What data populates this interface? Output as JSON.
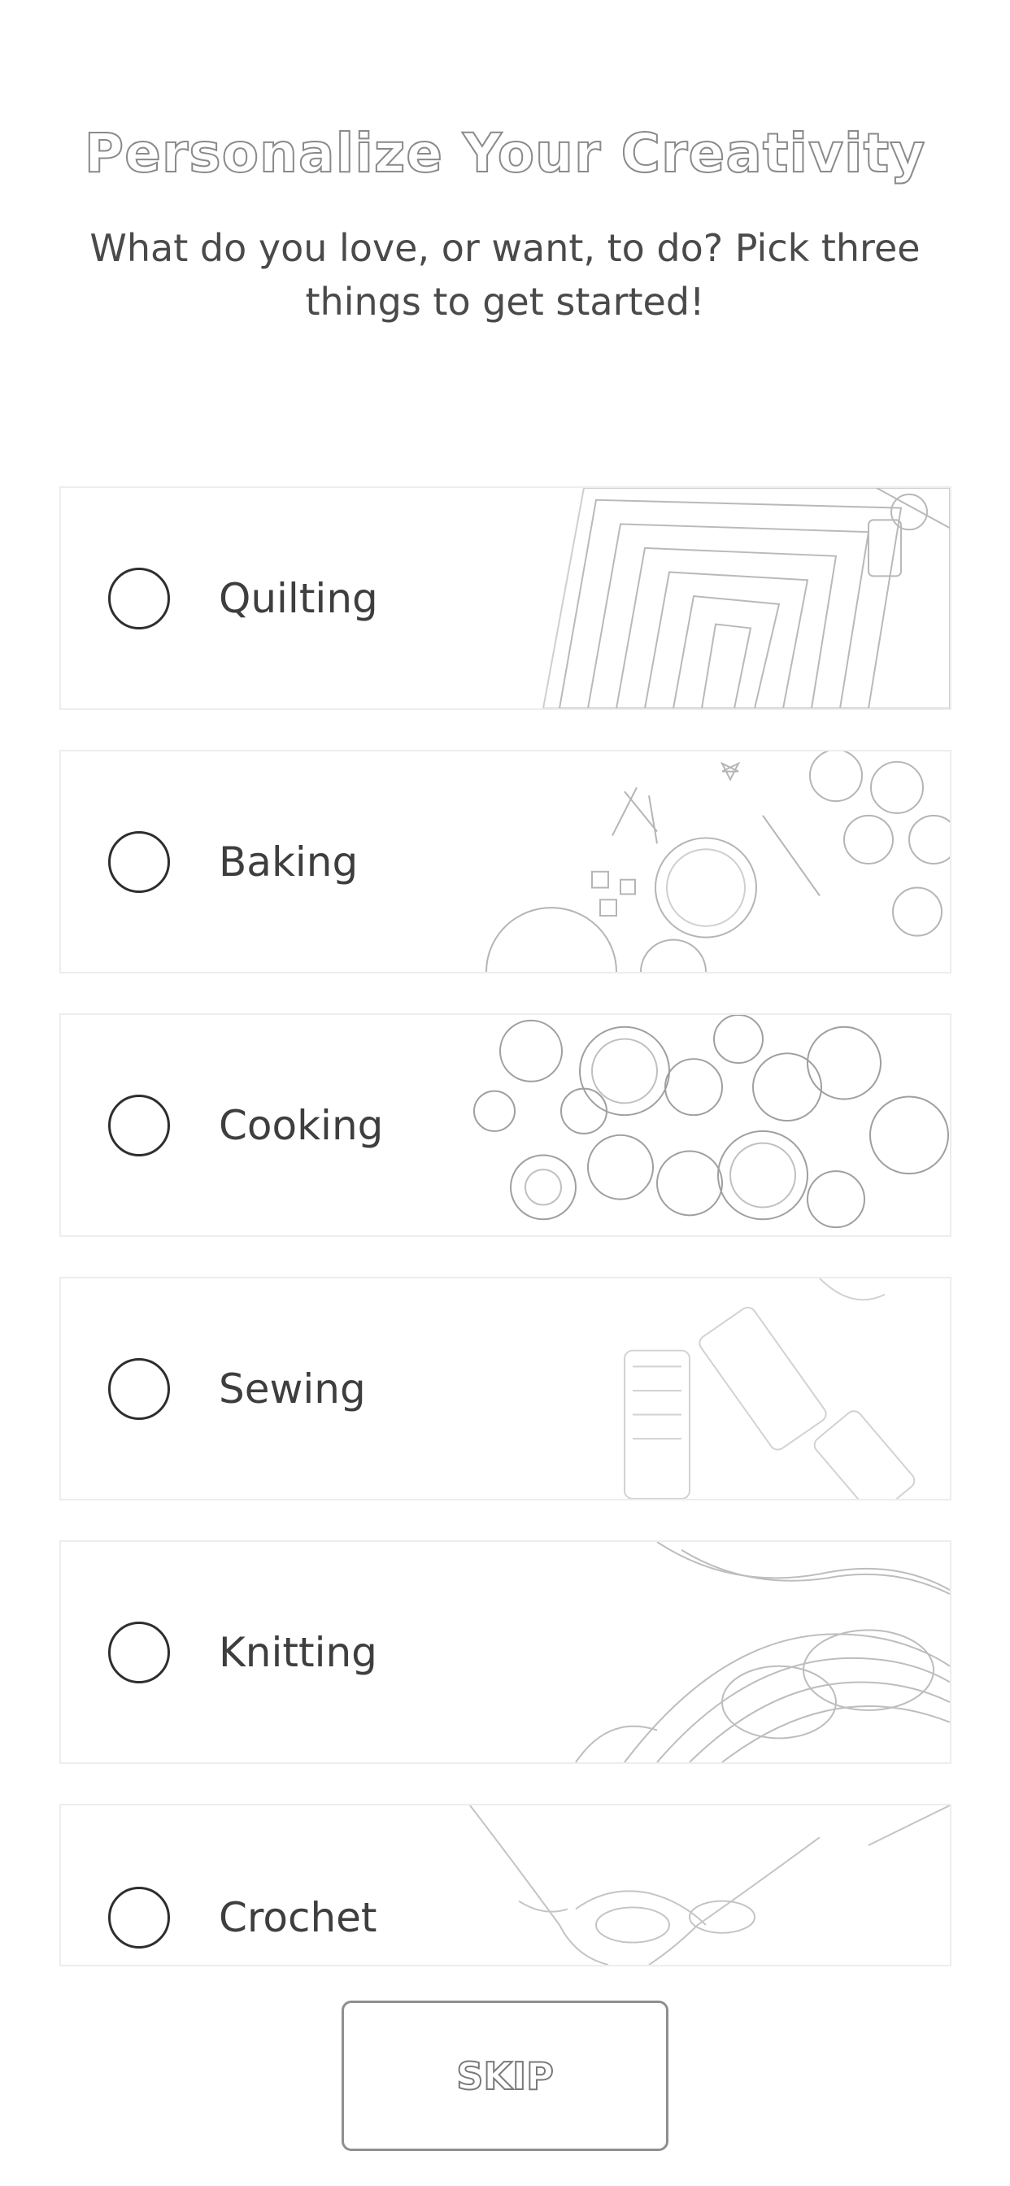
{
  "header": {
    "title": "Personalize Your Creativity",
    "subtitle": "What do you love, or want, to do? Pick three things to get started!"
  },
  "options": [
    {
      "label": "Quilting",
      "selected": false,
      "image_icon": "quilt-image"
    },
    {
      "label": "Baking",
      "selected": false,
      "image_icon": "baking-image"
    },
    {
      "label": "Cooking",
      "selected": false,
      "image_icon": "cooking-image"
    },
    {
      "label": "Sewing",
      "selected": false,
      "image_icon": "thread-spools-image"
    },
    {
      "label": "Knitting",
      "selected": false,
      "image_icon": "yarn-image"
    },
    {
      "label": "Crochet",
      "selected": false,
      "image_icon": "crochet-hands-image"
    }
  ],
  "footer": {
    "skip_label": "SKIP"
  },
  "colors": {
    "background": "#ffffff",
    "text": "#3e3e3e",
    "radio_border": "#2e2e2e",
    "card_border": "#ededed"
  }
}
